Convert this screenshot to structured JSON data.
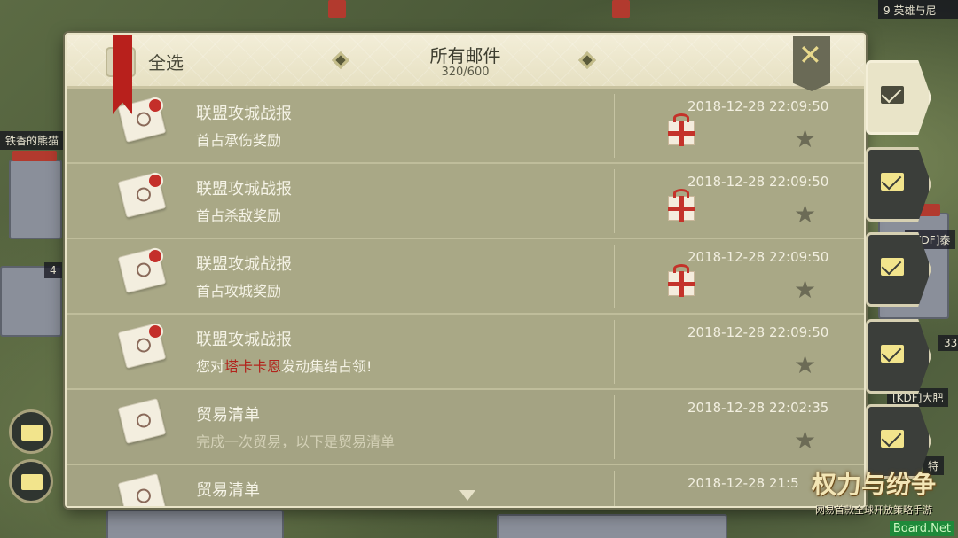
{
  "header": {
    "select_all_label": "全选",
    "title": "所有邮件",
    "count": "320/600",
    "close_symbol": "✕"
  },
  "mails": [
    {
      "title": "联盟攻城战报",
      "subtitle": "首占承伤奖励",
      "time": "2018-12-28 22:09:50",
      "has_gift": true,
      "unread": true
    },
    {
      "title": "联盟攻城战报",
      "subtitle": "首占杀敌奖励",
      "time": "2018-12-28 22:09:50",
      "has_gift": true,
      "unread": true
    },
    {
      "title": "联盟攻城战报",
      "subtitle": "首占攻城奖励",
      "time": "2018-12-28 22:09:50",
      "has_gift": true,
      "unread": true
    },
    {
      "title": "联盟攻城战报",
      "subtitle_pre": "您对",
      "subtitle_hl": "塔卡卡恩",
      "subtitle_post": "发动集结占领!",
      "time": "2018-12-28 22:09:50",
      "has_gift": false,
      "unread": true
    },
    {
      "title": "贸易清单",
      "subtitle": "完成一次贸易，以下是贸易清单",
      "time": "2018-12-28 22:02:35",
      "has_gift": false,
      "unread": false
    },
    {
      "title": "贸易清单",
      "time": "2018-12-28 21:5",
      "has_gift": false,
      "unread": false
    }
  ],
  "map_labels": {
    "top_right": "英雄与尼",
    "left_tag": "铁香的熊猫",
    "right_tag_1": "[KDF]泰",
    "right_tag_2": "[KDF]大肥",
    "right_num": "33",
    "right_char": "特",
    "top_left_num": "4",
    "top_right_num": "9"
  },
  "logo": {
    "main": "权力与纷争",
    "sub": "网易首款全球开放策略手游"
  },
  "watermark": "Board.Net",
  "colors": {
    "accent_red": "#c42f2a",
    "panel_bg": "#a8a785",
    "header_bg": "#f3eed8",
    "icon_yellow": "#f2e48c"
  }
}
